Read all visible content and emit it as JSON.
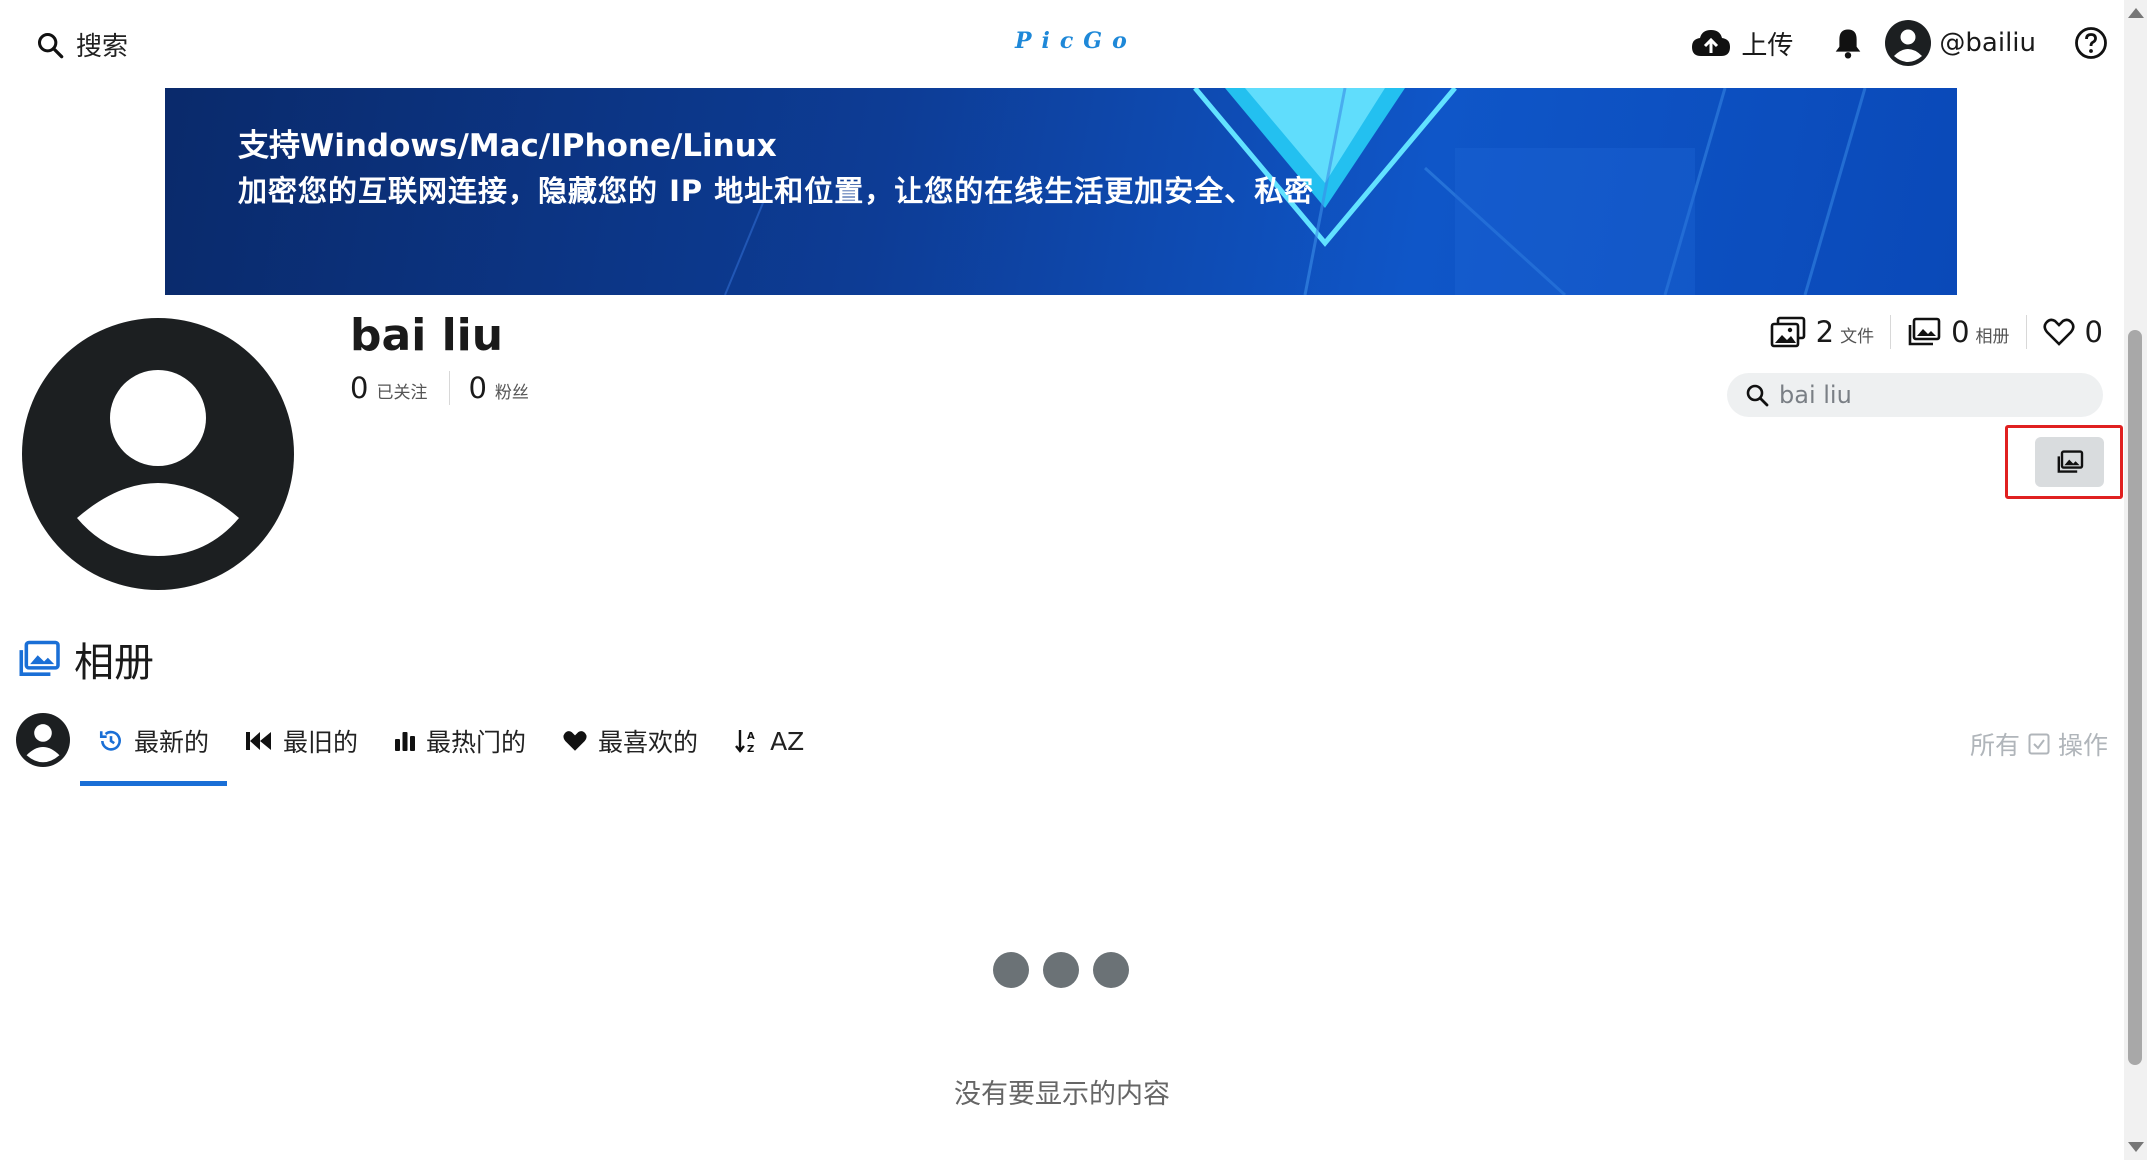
{
  "header": {
    "search_label": "搜索",
    "logo_text": "PicGo",
    "upload_label": "上传",
    "username": "@bailiu"
  },
  "banner": {
    "line1": "支持Windows/Mac/IPhone/Linux",
    "line2": "加密您的互联网连接，隐藏您的 IP 地址和位置，让您的在线生活更加安全、私密"
  },
  "profile": {
    "name": "bai liu",
    "following_count": "0",
    "following_label": "已关注",
    "followers_count": "0",
    "followers_label": "粉丝"
  },
  "stats": {
    "files_count": "2",
    "files_label": "文件",
    "albums_count": "0",
    "albums_label": "相册",
    "likes_count": "0"
  },
  "user_search": {
    "placeholder": "bai liu"
  },
  "section": {
    "title": "相册"
  },
  "tabs": [
    {
      "label": "最新的",
      "icon": "history-icon",
      "active": true
    },
    {
      "label": "最旧的",
      "icon": "rewind-icon",
      "active": false
    },
    {
      "label": "最热门的",
      "icon": "bar-chart-icon",
      "active": false
    },
    {
      "label": "最喜欢的",
      "icon": "heart-icon",
      "active": false
    },
    {
      "label": "AZ",
      "icon": "sort-az-icon",
      "active": false
    }
  ],
  "actions": {
    "all_label": "所有",
    "actions_label": "操作"
  },
  "empty_message": "没有要显示的内容",
  "colors": {
    "accent": "#1a6fd6",
    "logo": "#1e88d8",
    "highlight_box": "#e02020",
    "banner_bg": "#0d3c95",
    "loader_dot": "#6b7276"
  }
}
